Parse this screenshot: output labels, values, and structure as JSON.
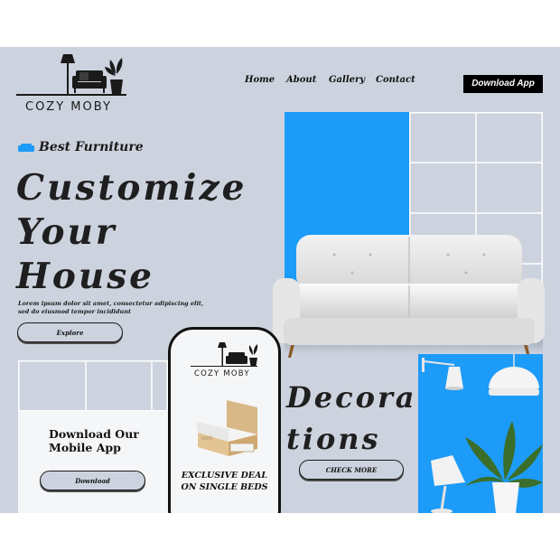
{
  "brand": {
    "name": "COZY MOBY"
  },
  "nav": {
    "items": [
      "Home",
      "About",
      "Gallery",
      "Contact"
    ],
    "download_app": "Download App"
  },
  "hero": {
    "tagline": "Best Furniture",
    "title_lines": [
      "Customize",
      "Your",
      "House"
    ],
    "lorem_line1": "Lorem ipsum dolor sit amet, consectetur adipiscing elit,",
    "lorem_line2": "sed do eiusmod tempor incididunt",
    "explore_label": "Explore"
  },
  "app_card": {
    "title_line1": "Download Our",
    "title_line2": "Mobile App",
    "button_label": "Download"
  },
  "phone": {
    "brand": "COZY MOBY",
    "deal_line1": "EXCLUSIVE DEAL",
    "deal_line2": "ON SINGLE BEDS"
  },
  "decor": {
    "title_line1": "Decora-",
    "title_line2": "tions",
    "button_label": "CHECK MORE"
  },
  "colors": {
    "page_bg": "#cdd3de",
    "accent_blue": "#1d9bf8",
    "text_dark": "#1f1f1f",
    "card_white": "#f5f6f8"
  },
  "icons": [
    "lamp-icon",
    "sofa-icon",
    "plant-icon",
    "sofa-badge-icon"
  ]
}
